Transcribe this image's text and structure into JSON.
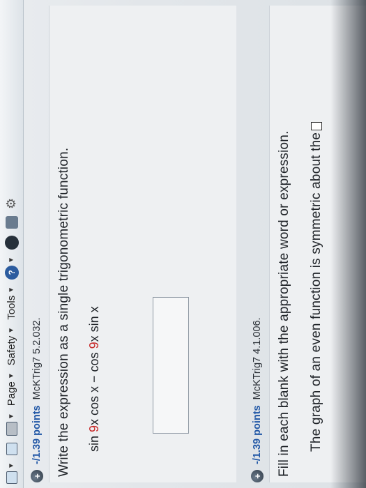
{
  "toolbar": {
    "page_label": "Page",
    "safety_label": "Safety",
    "tools_label": "Tools",
    "help_glyph": "?",
    "icons": [
      "home-icon",
      "email-icon",
      "print-icon",
      "help-icon",
      "globe-icon",
      "research-icon",
      "gear-icon"
    ]
  },
  "questions": [
    {
      "points": "-/1.39 points",
      "id": "McKTrig7 5.2.032.",
      "prompt": "Write the expression as a single trigonometric function.",
      "expression": {
        "part1": "sin ",
        "coef1": "9",
        "part2": "x cos x − cos ",
        "coef2": "9",
        "part3": "x sin x"
      },
      "answer_value": ""
    },
    {
      "points": "-/1.39 points",
      "id": "McKTrig7 4.1.006.",
      "prompt": "Fill in each blank with the appropriate word or expression.",
      "sentence": "The graph of an even function is symmetric about the"
    }
  ],
  "colors": {
    "points_link": "#2157a6",
    "highlight_coefficient": "#c62828"
  }
}
